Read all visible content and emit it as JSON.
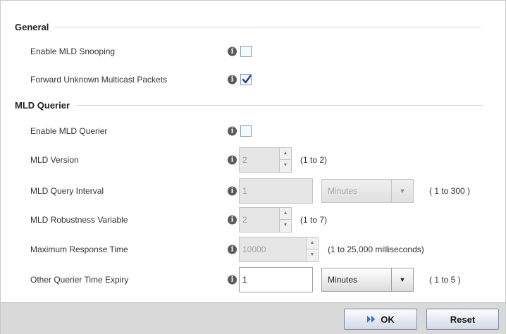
{
  "general": {
    "title": "General",
    "enable_mld_snooping": {
      "label": "Enable MLD Snooping",
      "checked": false
    },
    "forward_unknown": {
      "label": "Forward Unknown Multicast Packets",
      "checked": true
    }
  },
  "querier": {
    "title": "MLD Querier",
    "enable_querier": {
      "label": "Enable MLD Querier",
      "checked": false
    },
    "version": {
      "label": "MLD Version",
      "value": "2",
      "range": "(1 to 2)"
    },
    "query_interval": {
      "label": "MLD Query Interval",
      "value": "1",
      "unit": "Minutes",
      "range": "( 1 to 300 )"
    },
    "robustness": {
      "label": "MLD Robustness Variable",
      "value": "2",
      "range": "(1 to 7)"
    },
    "max_response": {
      "label": "Maximum Response Time",
      "value": "10000",
      "range": "(1 to 25,000 milliseconds)"
    },
    "other_querier": {
      "label": "Other Querier Time Expiry",
      "value": "1",
      "unit": "Minutes",
      "range": "( 1 to 5 )"
    }
  },
  "footer": {
    "ok_label": "OK",
    "reset_label": "Reset"
  },
  "icons": {
    "info": "info-icon",
    "check": "checkmark-icon",
    "ok": "play-double-icon",
    "dropdown": "chevron-down-icon"
  },
  "colors": {
    "checkbox_border": "#7f9db9",
    "check_mark": "#1f3f7a",
    "footer_bg": "#d9d9d9"
  }
}
